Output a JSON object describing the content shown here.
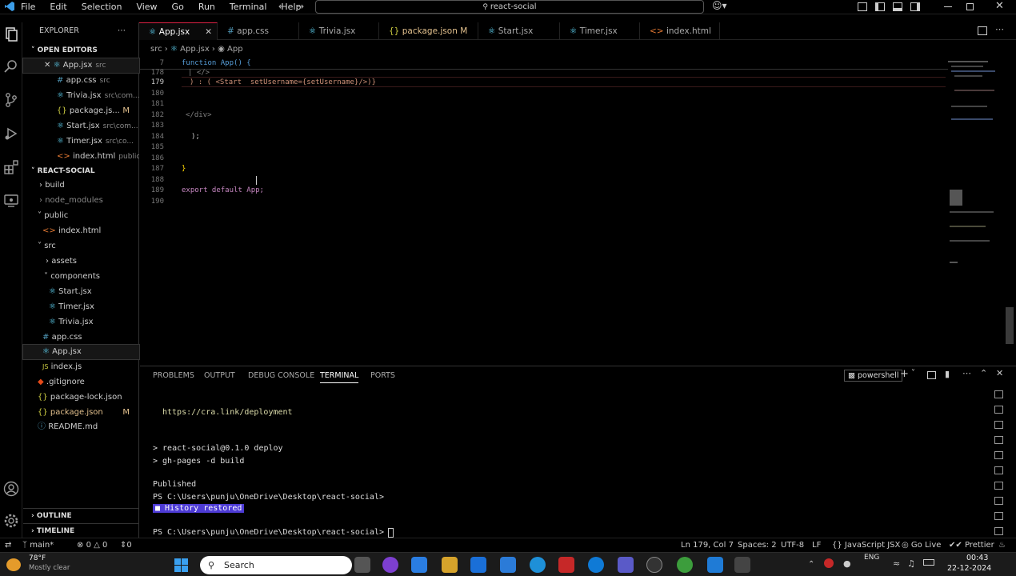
{
  "titlebar": {
    "menu": [
      "File",
      "Edit",
      "Selection",
      "View",
      "Go",
      "Run",
      "Terminal",
      "Help"
    ],
    "search": "react-social"
  },
  "sidebar": {
    "title": "EXPLORER",
    "open_editors_title": "OPEN EDITORS",
    "open_editors": [
      {
        "icon": "react-icon",
        "name": "App.jsx",
        "desc": "src"
      },
      {
        "icon": "css-icon",
        "name": "app.css",
        "desc": "src"
      },
      {
        "icon": "react-icon",
        "name": "Trivia.jsx",
        "desc": "src\\com..."
      },
      {
        "icon": "json-icon",
        "name": "package.js...",
        "desc": "M"
      },
      {
        "icon": "react-icon",
        "name": "Start.jsx",
        "desc": "src\\com..."
      },
      {
        "icon": "react-icon",
        "name": "Timer.jsx",
        "desc": "src\\co..."
      },
      {
        "icon": "html-icon",
        "name": "index.html",
        "desc": "public"
      }
    ],
    "project_title": "REACT-SOCIAL",
    "tree": {
      "build": "build",
      "node_modules": "node_modules",
      "public": "public",
      "index_html": "index.html",
      "src": "src",
      "assets": "assets",
      "components": "components",
      "start": "Start.jsx",
      "timer": "Timer.jsx",
      "trivia": "Trivia.jsx",
      "app_css": "app.css",
      "app_jsx": "App.jsx",
      "index_js": "index.js",
      "gitignore": ".gitignore",
      "package_lock": "package-lock.json",
      "package_json": "package.json",
      "package_json_mod": "M",
      "readme": "README.md"
    },
    "outline": "OUTLINE",
    "timeline": "TIMELINE"
  },
  "tabs": [
    {
      "icon": "react-icon",
      "label": "App.jsx",
      "active": true
    },
    {
      "icon": "css-icon",
      "label": "app.css"
    },
    {
      "icon": "react-icon",
      "label": "Trivia.jsx"
    },
    {
      "icon": "json-icon",
      "label": "package.json",
      "mod": "M"
    },
    {
      "icon": "react-icon",
      "label": "Start.jsx"
    },
    {
      "icon": "react-icon",
      "label": "Timer.jsx"
    },
    {
      "icon": "html-icon",
      "label": "index.html"
    }
  ],
  "breadcrumb": {
    "a": "src",
    "b": "App.jsx",
    "c": "App"
  },
  "editor": {
    "sticky_ln": "7",
    "sticky_code": "function App() {",
    "lines": [
      {
        "n": "178",
        "code": "| </>"
      },
      {
        "n": "179",
        "code": ") : ( <Start  setUsername={setUsername}/>)}"
      },
      {
        "n": "180",
        "code": ""
      },
      {
        "n": "181",
        "code": ""
      },
      {
        "n": "182",
        "code": "</div>"
      },
      {
        "n": "183",
        "code": ""
      },
      {
        "n": "184",
        "code": ");"
      },
      {
        "n": "185",
        "code": ""
      },
      {
        "n": "186",
        "code": ""
      },
      {
        "n": "187",
        "code": "}"
      },
      {
        "n": "188",
        "code": ""
      },
      {
        "n": "189",
        "code": "export default App;"
      },
      {
        "n": "190",
        "code": ""
      }
    ]
  },
  "panel": {
    "tabs": [
      "PROBLEMS",
      "OUTPUT",
      "DEBUG CONSOLE",
      "TERMINAL",
      "PORTS"
    ],
    "shell": "powershell",
    "terminal": {
      "link": "https://cra.link/deployment",
      "cmd1": "> react-social@0.1.0 deploy",
      "cmd2": "> gh-pages -d build",
      "published": "Published",
      "prompt1": "PS C:\\Users\\punju\\OneDrive\\Desktop\\react-social>",
      "restored": "History restored",
      "prompt2": "PS C:\\Users\\punju\\OneDrive\\Desktop\\react-social>"
    }
  },
  "status": {
    "branch": "main*",
    "errors": "0",
    "warnings": "0",
    "ports": "0",
    "position": "Ln 179, Col 7",
    "spaces": "Spaces: 2",
    "encoding": "UTF-8",
    "eol": "LF",
    "language": "JavaScript JSX",
    "golive": "Go Live",
    "prettier": "Prettier"
  },
  "taskbar": {
    "weather_temp": "78°F",
    "weather_desc": "Mostly clear",
    "search": "Search",
    "lang": "ENG",
    "time": "00:43",
    "date": "22-12-2024"
  },
  "colors": {
    "accent": "#d24",
    "keyword": "#569cd6",
    "tag": "#808080",
    "string": "#ce9178",
    "link": "#dcdcaa",
    "highlight": "#4d3bd6"
  }
}
